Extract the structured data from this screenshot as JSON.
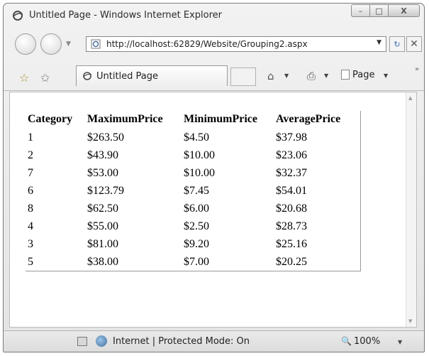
{
  "window": {
    "title": "Untitled Page - Windows Internet Explorer",
    "minimize_glyph": "–",
    "maximize_glyph": "□",
    "close_glyph": "X"
  },
  "address_bar": {
    "url": "http://localhost:62829/Website/Grouping2.aspx"
  },
  "tab": {
    "label": "Untitled Page"
  },
  "command_bar": {
    "page_label": "Page"
  },
  "table": {
    "headers": [
      "Category",
      "MaximumPrice",
      "MinimumPrice",
      "AveragePrice"
    ],
    "rows": [
      [
        "1",
        "$263.50",
        "$4.50",
        "$37.98"
      ],
      [
        "2",
        "$43.90",
        "$10.00",
        "$23.06"
      ],
      [
        "7",
        "$53.00",
        "$10.00",
        "$32.37"
      ],
      [
        "6",
        "$123.79",
        "$7.45",
        "$54.01"
      ],
      [
        "8",
        "$62.50",
        "$6.00",
        "$20.68"
      ],
      [
        "4",
        "$55.00",
        "$2.50",
        "$28.73"
      ],
      [
        "3",
        "$81.00",
        "$9.20",
        "$25.16"
      ],
      [
        "5",
        "$38.00",
        "$7.00",
        "$20.25"
      ]
    ]
  },
  "status_bar": {
    "zone_text": "Internet | Protected Mode: On",
    "zoom": "100%"
  }
}
